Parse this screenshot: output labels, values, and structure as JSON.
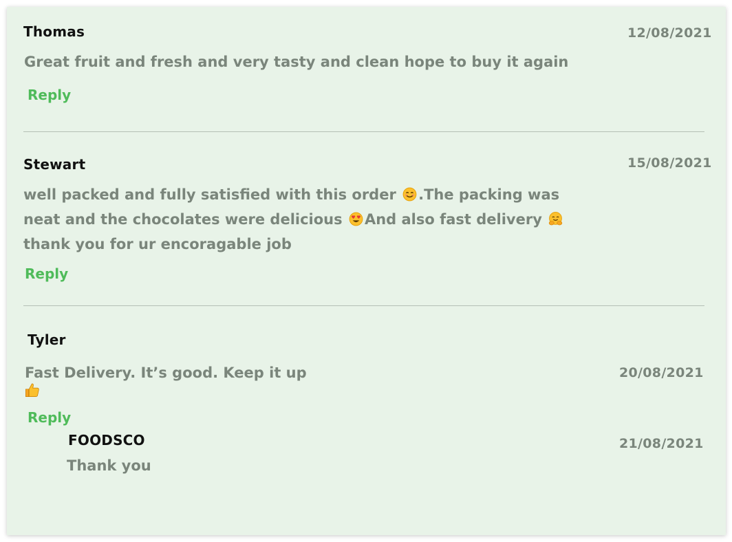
{
  "reviews": [
    {
      "name": "Thomas",
      "date": "12/08/2021",
      "lines": [
        "Great fruit and fresh and very tasty  and clean hope to buy it again"
      ],
      "reply": "Reply"
    },
    {
      "name": "Stewart",
      "date": "15/08/2021",
      "lines": [
        "well packed and fully satisfied with this order",
        ".The packing was",
        "neat and the chocolates were delicious",
        "And also fast delivery",
        "thank you for ur encoragable job"
      ],
      "emojis": [
        "smiling-face-emoji",
        "heart-eyes-emoji",
        "hugging-face-emoji"
      ],
      "reply": "Reply"
    },
    {
      "name": "Tyler",
      "date": "20/08/2021",
      "lines": [
        "Fast Delivery. It’s good. Keep it up"
      ],
      "emojis": [
        "thumbs-up-emoji"
      ],
      "reply": "Reply",
      "responses": [
        {
          "name": "FOODSCO",
          "date": "21/08/2021",
          "text": "Thank you"
        }
      ]
    }
  ],
  "colors": {
    "card_background": "#e8f3e8",
    "name_text": "#111111",
    "body_text": "#7a857b",
    "reply_link": "#4fbb5a",
    "divider": "#b4bfb5"
  }
}
